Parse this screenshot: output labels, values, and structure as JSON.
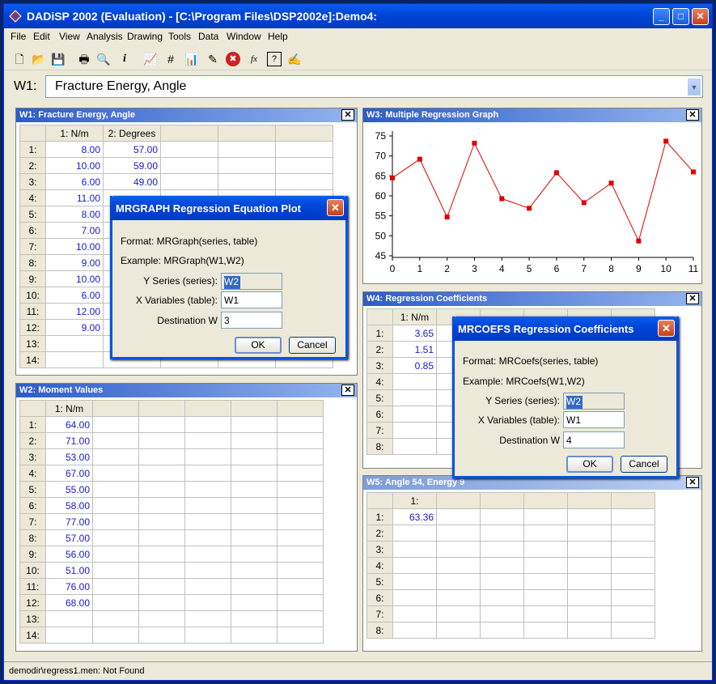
{
  "app": {
    "title": "DADiSP 2002 (Evaluation) - [C:\\Program Files\\DSP2002e]:Demo4:",
    "minimize": "_",
    "maximize": "□",
    "close": "✕",
    "icon": "dadisp-app-icon"
  },
  "menu": [
    "File",
    "Edit",
    "View",
    "Analysis",
    "Drawing",
    "Tools",
    "Data",
    "Window",
    "Help"
  ],
  "toolbar": {
    "icons": [
      "new-icon",
      "open-icon",
      "save-icon",
      "print-icon",
      "print-preview-icon",
      "info-icon",
      "line-chart-icon",
      "grid-icon",
      "bar-chart-icon",
      "annotate-icon",
      "stop-icon",
      "function-icon",
      "help-icon",
      "edit-icon"
    ],
    "glyphs": [
      "🗋",
      "📂",
      "💾",
      "🖶",
      "🔍",
      "i",
      "📈",
      "#",
      "📊",
      "✎",
      "✖",
      "fx",
      "?",
      "✍"
    ]
  },
  "window_selector": {
    "label": "W1:",
    "value": "Fracture Energy, Angle"
  },
  "w1": {
    "title": "W1: Fracture Energy, Angle",
    "headers": [
      "1: N/m",
      "2: Degrees"
    ],
    "rows": [
      {
        "n": "1:",
        "a": "8.00",
        "b": "57.00"
      },
      {
        "n": "2:",
        "a": "10.00",
        "b": "59.00"
      },
      {
        "n": "3:",
        "a": "6.00",
        "b": "49.00"
      },
      {
        "n": "4:",
        "a": "11.00",
        "b": ""
      },
      {
        "n": "5:",
        "a": "8.00",
        "b": ""
      },
      {
        "n": "6:",
        "a": "7.00",
        "b": ""
      },
      {
        "n": "7:",
        "a": "10.00",
        "b": ""
      },
      {
        "n": "8:",
        "a": "9.00",
        "b": ""
      },
      {
        "n": "9:",
        "a": "10.00",
        "b": ""
      },
      {
        "n": "10:",
        "a": "6.00",
        "b": ""
      },
      {
        "n": "11:",
        "a": "12.00",
        "b": ""
      },
      {
        "n": "12:",
        "a": "9.00",
        "b": ""
      },
      {
        "n": "13:",
        "a": "",
        "b": ""
      },
      {
        "n": "14:",
        "a": "",
        "b": ""
      }
    ]
  },
  "w2": {
    "title": "W2: Moment Values",
    "headers": [
      "1: N/m"
    ],
    "rows": [
      {
        "n": "1:",
        "a": "64.00"
      },
      {
        "n": "2:",
        "a": "71.00"
      },
      {
        "n": "3:",
        "a": "53.00"
      },
      {
        "n": "4:",
        "a": "67.00"
      },
      {
        "n": "5:",
        "a": "55.00"
      },
      {
        "n": "6:",
        "a": "58.00"
      },
      {
        "n": "7:",
        "a": "77.00"
      },
      {
        "n": "8:",
        "a": "57.00"
      },
      {
        "n": "9:",
        "a": "56.00"
      },
      {
        "n": "10:",
        "a": "51.00"
      },
      {
        "n": "11:",
        "a": "76.00"
      },
      {
        "n": "12:",
        "a": "68.00"
      },
      {
        "n": "13:",
        "a": ""
      },
      {
        "n": "14:",
        "a": ""
      }
    ]
  },
  "w3": {
    "title": "W3: Multiple Regression Graph"
  },
  "chart_data": {
    "type": "line",
    "title": "",
    "xlabel": "",
    "ylabel": "",
    "x": [
      0,
      1,
      2,
      3,
      4,
      5,
      6,
      7,
      8,
      9,
      10,
      11
    ],
    "series": [
      {
        "values": [
          64.5,
          69.2,
          54.7,
          73.2,
          59.3,
          56.9,
          65.8,
          58.3,
          63.2,
          48.7,
          73.7,
          66.0
        ]
      }
    ],
    "xticks": [
      "0",
      "1",
      "2",
      "3",
      "4",
      "5",
      "6",
      "7",
      "8",
      "9",
      "10",
      "11"
    ],
    "yticks": [
      "45",
      "50",
      "55",
      "60",
      "65",
      "70",
      "75"
    ],
    "ylim": [
      45,
      75
    ],
    "xlim": [
      0,
      11
    ],
    "color": "#e00000",
    "grid": false
  },
  "w4": {
    "title": "W4: Regression Coefficients",
    "headers": [
      "1: N/m"
    ],
    "rows": [
      {
        "n": "1:",
        "a": "3.65"
      },
      {
        "n": "2:",
        "a": "1.51"
      },
      {
        "n": "3:",
        "a": "0.85"
      },
      {
        "n": "4:",
        "a": ""
      },
      {
        "n": "5:",
        "a": ""
      },
      {
        "n": "6:",
        "a": ""
      },
      {
        "n": "7:",
        "a": ""
      },
      {
        "n": "8:",
        "a": ""
      }
    ]
  },
  "w5": {
    "title": "W5: Angle 54, Energy 9",
    "headers": [
      "1:"
    ],
    "rows": [
      {
        "n": "1:",
        "a": "63.36"
      },
      {
        "n": "2:",
        "a": ""
      },
      {
        "n": "3:",
        "a": ""
      },
      {
        "n": "4:",
        "a": ""
      },
      {
        "n": "5:",
        "a": ""
      },
      {
        "n": "6:",
        "a": ""
      },
      {
        "n": "7:",
        "a": ""
      },
      {
        "n": "8:",
        "a": ""
      }
    ]
  },
  "dialog1": {
    "title": "MRGRAPH  Regression Equation Plot",
    "format": "Format:  MRGraph(series, table)",
    "example": "Example:  MRGraph(W1,W2)",
    "y_label": "Y Series (series):",
    "y_value": "W2",
    "x_label": "X Variables (table):",
    "x_value": "W1",
    "d_label": "Destination W",
    "d_value": "3",
    "ok": "OK",
    "cancel": "Cancel"
  },
  "dialog2": {
    "title": "MRCOEFS  Regression Coefficients",
    "format": "Format:  MRCoefs(series, table)",
    "example": "Example:  MRCoefs(W1,W2)",
    "y_label": "Y Series (series):",
    "y_value": "W2",
    "x_label": "X Variables (table):",
    "x_value": "W1",
    "d_label": "Destination W",
    "d_value": "4",
    "ok": "OK",
    "cancel": "Cancel"
  },
  "status": "demodir\\regress1.men: Not Found"
}
